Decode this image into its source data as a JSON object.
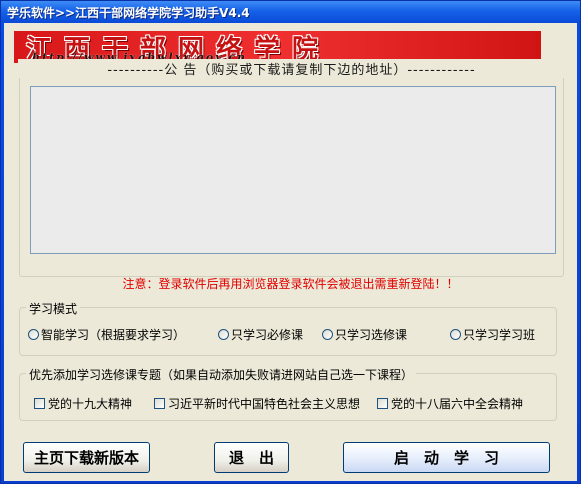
{
  "window": {
    "title": "学乐软件>>江西干部网络学院学习助手V4.4"
  },
  "banner": {
    "title": "江西干部网络学院",
    "url": "http://www.jxgbwlxy.gov.cn",
    "color": "#e01e1e"
  },
  "notice": {
    "legend": "----------公 告（购买或下载请复制下边的地址）------------",
    "content": ""
  },
  "warning": "注意：登录软件后再用浏览器登录软件会被退出需重新登陆！！",
  "study_mode": {
    "legend": "学习模式",
    "options": [
      {
        "label": "智能学习（根据要求学习）"
      },
      {
        "label": "只学习必修课"
      },
      {
        "label": "只学习选修课"
      },
      {
        "label": "只学习学习班"
      }
    ]
  },
  "topics": {
    "legend": "优先添加学习选修课专题（如果自动添加失败请进网站自己选一下课程）",
    "options": [
      {
        "label": "党的十九大精神"
      },
      {
        "label": "习近平新时代中国特色社会主义思想"
      },
      {
        "label": "党的十八届六中全会精神"
      }
    ]
  },
  "buttons": {
    "download": "主页下载新版本",
    "exit": "退　出",
    "start": "启　动　学　习"
  },
  "colors": {
    "titlebar": "#0a4ad8",
    "warning_text": "#e00000",
    "client_bg": "#ece9d8"
  }
}
